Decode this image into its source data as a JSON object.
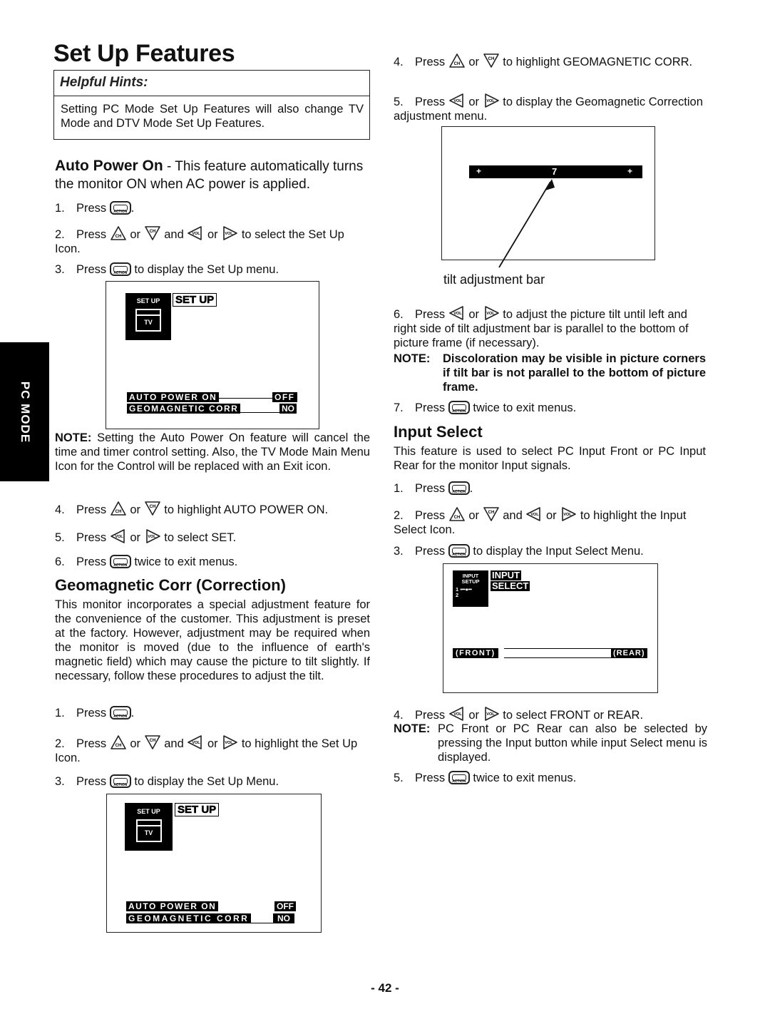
{
  "page": {
    "title": "Set Up Features",
    "side_tab": "PC MODE",
    "page_number": "- 42 -"
  },
  "hints": {
    "heading": "Helpful Hints:",
    "body": "Setting PC Mode Set Up Features will also change TV Mode and DTV Mode Set Up Features."
  },
  "icons": {
    "action": "ACTION",
    "ch": "CH",
    "vol": "VOL"
  },
  "auto_power": {
    "heading": "Auto Power On",
    "intro": " - This feature automatically turns the monitor ON when AC power is applied.",
    "steps": [
      {
        "num": "1.",
        "pre": "Press",
        "post": "."
      },
      {
        "num": "2.",
        "pre": "Press",
        "or1": "or",
        "and": "and",
        "or2": "or",
        "post": "to select the Set Up Icon."
      },
      {
        "num": "3.",
        "pre": "Press",
        "post": "to display the Set Up menu."
      },
      {
        "num": "4.",
        "pre": "Press",
        "or1": "or",
        "post": "to highlight AUTO POWER ON."
      },
      {
        "num": "5.",
        "pre": "Press",
        "or1": "or",
        "post": "to select SET."
      },
      {
        "num": "6.",
        "pre": "Press",
        "post": "twice to exit menus."
      }
    ],
    "note_label": "NOTE:",
    "note": " Setting the Auto Power On feature will cancel the time and timer control setting. Also, the TV Mode Main Menu Icon for the Control will be replaced with an Exit icon."
  },
  "setup_screen_1": {
    "icon_label": "SET UP",
    "icon_sub": "TV",
    "menu_title": "SET UP",
    "rows": [
      {
        "label": "AUTO POWER ON",
        "value": "OFF"
      },
      {
        "label": "GEOMAGNETIC CORR",
        "value": "NO"
      }
    ]
  },
  "geomagnetic": {
    "heading": "Geomagnetic Corr (Correction)",
    "intro": "This monitor incorporates a special adjustment feature for the convenience of the customer. This adjustment is preset at the factory. However, adjustment may be required when the monitor is moved (due to the influence of earth's magnetic field) which may cause the picture to tilt slightly. If necessary, follow these procedures to adjust the tilt.",
    "steps": [
      {
        "num": "1.",
        "pre": "Press",
        "post": "."
      },
      {
        "num": "2.",
        "pre": "Press",
        "or1": "or",
        "and": "and",
        "or2": "or",
        "post": "to highlight the Set Up Icon."
      },
      {
        "num": "3.",
        "pre": "Press",
        "post": "to display the Set Up Menu."
      },
      {
        "num": "4.",
        "pre": "Press",
        "or1": "or",
        "post": "to highlight GEOMAGNETIC CORR."
      },
      {
        "num": "5.",
        "pre": "Press",
        "or1": "or",
        "post": "to display the Geomagnetic Correction adjustment menu."
      },
      {
        "num": "6.",
        "pre": "Press",
        "or1": "or",
        "post": "to adjust the picture tilt until left and right side of tilt adjustment bar is parallel to the bottom of picture frame (if necessary)."
      },
      {
        "num": "7.",
        "pre": "Press",
        "post": "twice to exit menus."
      }
    ],
    "note_label": "NOTE:",
    "note": "Discoloration may be visible in picture corners if tilt bar is not parallel to the bottom of picture frame.",
    "tilt_caption": "tilt adjustment bar",
    "tilt_bar": {
      "left": "+",
      "value": "7",
      "right": "+"
    }
  },
  "setup_screen_2": {
    "icon_label": "SET UP",
    "icon_sub": "TV",
    "menu_title": "SET UP",
    "rows": [
      {
        "label": "AUTO POWER ON",
        "value": "OFF"
      },
      {
        "label": "GEOMAGNETIC CORR",
        "value": "NO"
      }
    ]
  },
  "input_select": {
    "heading": "Input Select",
    "intro": "This feature is used to select PC Input Front or PC Input Rear for the monitor Input signals.",
    "steps": [
      {
        "num": "1.",
        "pre": "Press",
        "post": "."
      },
      {
        "num": "2.",
        "pre": "Press",
        "or1": "or",
        "and": "and",
        "or2": "or",
        "post": "to highlight the Input Select Icon."
      },
      {
        "num": "3.",
        "pre": "Press",
        "post": "to display the Input Select Menu."
      },
      {
        "num": "4.",
        "pre": "Press",
        "or1": "or",
        "post": "to select FRONT or REAR."
      },
      {
        "num": "5.",
        "pre": "Press",
        "post": "twice to exit menus."
      }
    ],
    "note_label": "NOTE:",
    "note": "PC Front or PC Rear can also be selected by pressing the Input button while input Select menu is displayed.",
    "screen": {
      "icon_line1": "INPUT",
      "icon_line2": "SETUP",
      "icon_line3": "1",
      "icon_line4": "2",
      "title_line1": "INPUT",
      "title_line2": "SELECT",
      "front": "(FRONT)",
      "rear": "(REAR)"
    }
  }
}
